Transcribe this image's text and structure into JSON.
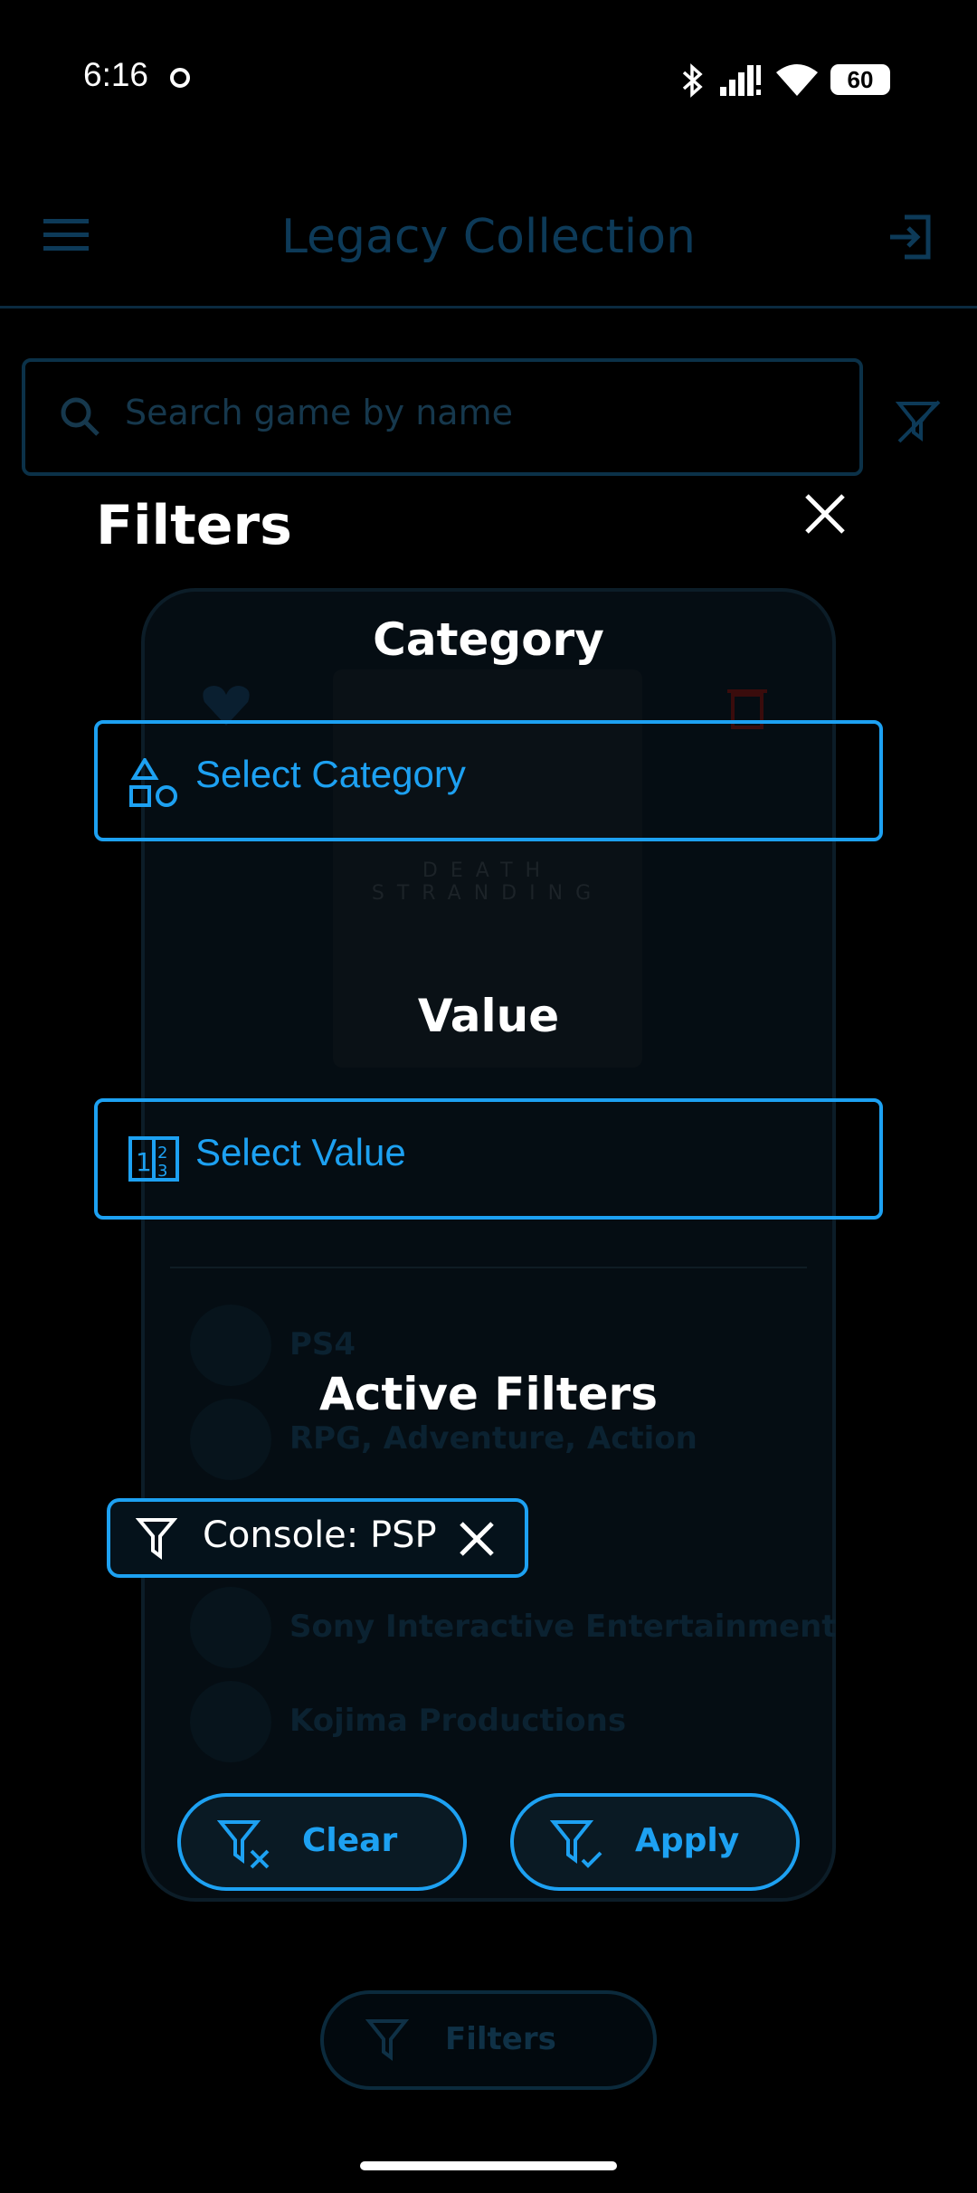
{
  "status_bar": {
    "time": "6:16",
    "battery": "60"
  },
  "app": {
    "title": "Legacy Collection",
    "search_placeholder": "Search game by name",
    "cover_title": "DEATH STRANDING",
    "info": [
      "PS4",
      "RPG, Adventure, Action",
      "Sony Interactive Entertainment",
      "Kojima Productions"
    ],
    "filters_button": "Filters"
  },
  "filters_modal": {
    "title": "Filters",
    "category_heading": "Category",
    "category_select": "Select Category",
    "value_heading": "Value",
    "value_select": "Select Value",
    "active_heading": "Active Filters",
    "active_chips": [
      "Console: PSP"
    ],
    "clear_label": "Clear",
    "apply_label": "Apply"
  },
  "colors": {
    "accent": "#1da1f2",
    "background": "#000000"
  }
}
